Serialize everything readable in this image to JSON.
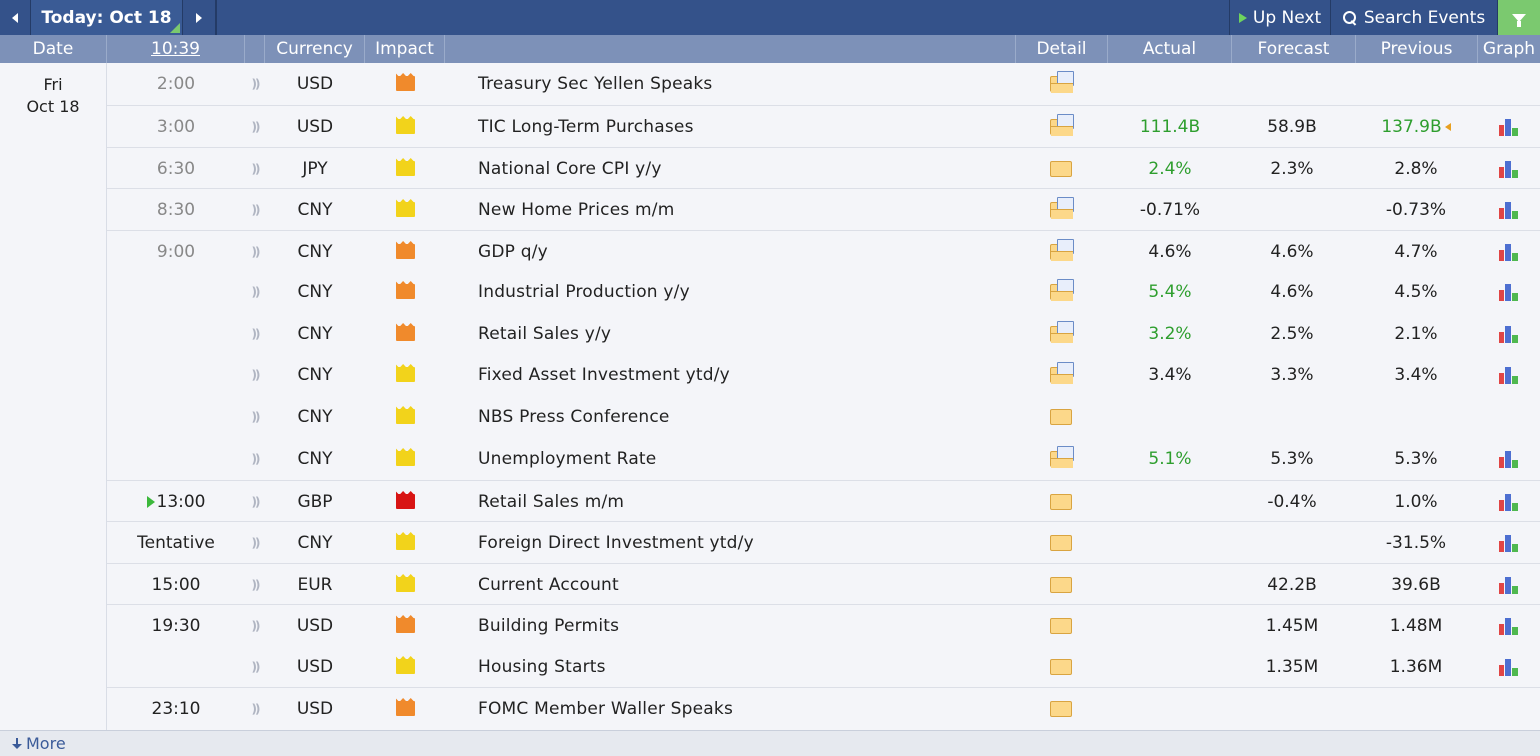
{
  "toolbar": {
    "today_label": "Today: Oct 18",
    "up_next_label": "Up Next",
    "search_label": "Search Events"
  },
  "columns": {
    "date": "Date",
    "time": "10:39",
    "currency": "Currency",
    "impact": "Impact",
    "detail": "Detail",
    "actual": "Actual",
    "forecast": "Forecast",
    "previous": "Previous",
    "graph": "Graph"
  },
  "day": {
    "weekday": "Fri",
    "date": "Oct 18"
  },
  "events": [
    {
      "time": "2:00",
      "currency": "USD",
      "impact": "medium",
      "title": "Treasury Sec Yellen Speaks",
      "detail_rich": true,
      "actual": "",
      "actual_better": false,
      "forecast": "",
      "previous": "",
      "previous_better": false,
      "revised": false,
      "graph": false
    },
    {
      "time": "3:00",
      "currency": "USD",
      "impact": "low",
      "title": "TIC Long-Term Purchases",
      "detail_rich": true,
      "actual": "111.4B",
      "actual_better": true,
      "forecast": "58.9B",
      "previous": "137.9B",
      "previous_better": true,
      "revised": true,
      "graph": true
    },
    {
      "time": "6:30",
      "currency": "JPY",
      "impact": "low",
      "title": "National Core CPI y/y",
      "detail_rich": false,
      "actual": "2.4%",
      "actual_better": true,
      "forecast": "2.3%",
      "previous": "2.8%",
      "previous_better": false,
      "revised": false,
      "graph": true
    },
    {
      "time": "8:30",
      "currency": "CNY",
      "impact": "low",
      "title": "New Home Prices m/m",
      "detail_rich": true,
      "actual": "-0.71%",
      "actual_better": false,
      "forecast": "",
      "previous": "-0.73%",
      "previous_better": false,
      "revised": false,
      "graph": true
    },
    {
      "time": "9:00",
      "currency": "CNY",
      "impact": "medium",
      "title": "GDP q/y",
      "detail_rich": true,
      "actual": "4.6%",
      "actual_better": false,
      "forecast": "4.6%",
      "previous": "4.7%",
      "previous_better": false,
      "revised": false,
      "graph": true
    },
    {
      "time": "",
      "currency": "CNY",
      "impact": "medium",
      "title": "Industrial Production y/y",
      "detail_rich": true,
      "actual": "5.4%",
      "actual_better": true,
      "forecast": "4.6%",
      "previous": "4.5%",
      "previous_better": false,
      "revised": false,
      "graph": true
    },
    {
      "time": "",
      "currency": "CNY",
      "impact": "medium",
      "title": "Retail Sales y/y",
      "detail_rich": true,
      "actual": "3.2%",
      "actual_better": true,
      "forecast": "2.5%",
      "previous": "2.1%",
      "previous_better": false,
      "revised": false,
      "graph": true
    },
    {
      "time": "",
      "currency": "CNY",
      "impact": "low",
      "title": "Fixed Asset Investment ytd/y",
      "detail_rich": true,
      "actual": "3.4%",
      "actual_better": false,
      "forecast": "3.3%",
      "previous": "3.4%",
      "previous_better": false,
      "revised": false,
      "graph": true
    },
    {
      "time": "",
      "currency": "CNY",
      "impact": "low",
      "title": "NBS Press Conference",
      "detail_rich": false,
      "actual": "",
      "actual_better": false,
      "forecast": "",
      "previous": "",
      "previous_better": false,
      "revised": false,
      "graph": false
    },
    {
      "time": "",
      "currency": "CNY",
      "impact": "low",
      "title": "Unemployment Rate",
      "detail_rich": true,
      "actual": "5.1%",
      "actual_better": true,
      "forecast": "5.3%",
      "previous": "5.3%",
      "previous_better": false,
      "revised": false,
      "graph": true
    },
    {
      "time": "13:00",
      "currency": "GBP",
      "impact": "high",
      "title": "Retail Sales m/m",
      "detail_rich": false,
      "actual": "",
      "actual_better": false,
      "forecast": "-0.4%",
      "previous": "1.0%",
      "previous_better": false,
      "revised": false,
      "graph": true,
      "now": true
    },
    {
      "time": "Tentative",
      "currency": "CNY",
      "impact": "low",
      "title": "Foreign Direct Investment ytd/y",
      "detail_rich": false,
      "actual": "",
      "actual_better": false,
      "forecast": "",
      "previous": "-31.5%",
      "previous_better": false,
      "revised": false,
      "graph": true
    },
    {
      "time": "15:00",
      "currency": "EUR",
      "impact": "low",
      "title": "Current Account",
      "detail_rich": false,
      "actual": "",
      "actual_better": false,
      "forecast": "42.2B",
      "previous": "39.6B",
      "previous_better": false,
      "revised": false,
      "graph": true
    },
    {
      "time": "19:30",
      "currency": "USD",
      "impact": "medium",
      "title": "Building Permits",
      "detail_rich": false,
      "actual": "",
      "actual_better": false,
      "forecast": "1.45M",
      "previous": "1.48M",
      "previous_better": false,
      "revised": false,
      "graph": true
    },
    {
      "time": "",
      "currency": "USD",
      "impact": "low",
      "title": "Housing Starts",
      "detail_rich": false,
      "actual": "",
      "actual_better": false,
      "forecast": "1.35M",
      "previous": "1.36M",
      "previous_better": false,
      "revised": false,
      "graph": true
    },
    {
      "time": "23:10",
      "currency": "USD",
      "impact": "medium",
      "title": "FOMC Member Waller Speaks",
      "detail_rich": false,
      "actual": "",
      "actual_better": false,
      "forecast": "",
      "previous": "",
      "previous_better": false,
      "revised": false,
      "graph": false
    }
  ],
  "footer": {
    "more_label": "More"
  },
  "colors": {
    "accent": "#2e4a7e",
    "header": "#7d91b8",
    "better": "#2e9e2e",
    "high": "#d81414",
    "medium": "#f08a2c",
    "low": "#f2d31b"
  }
}
